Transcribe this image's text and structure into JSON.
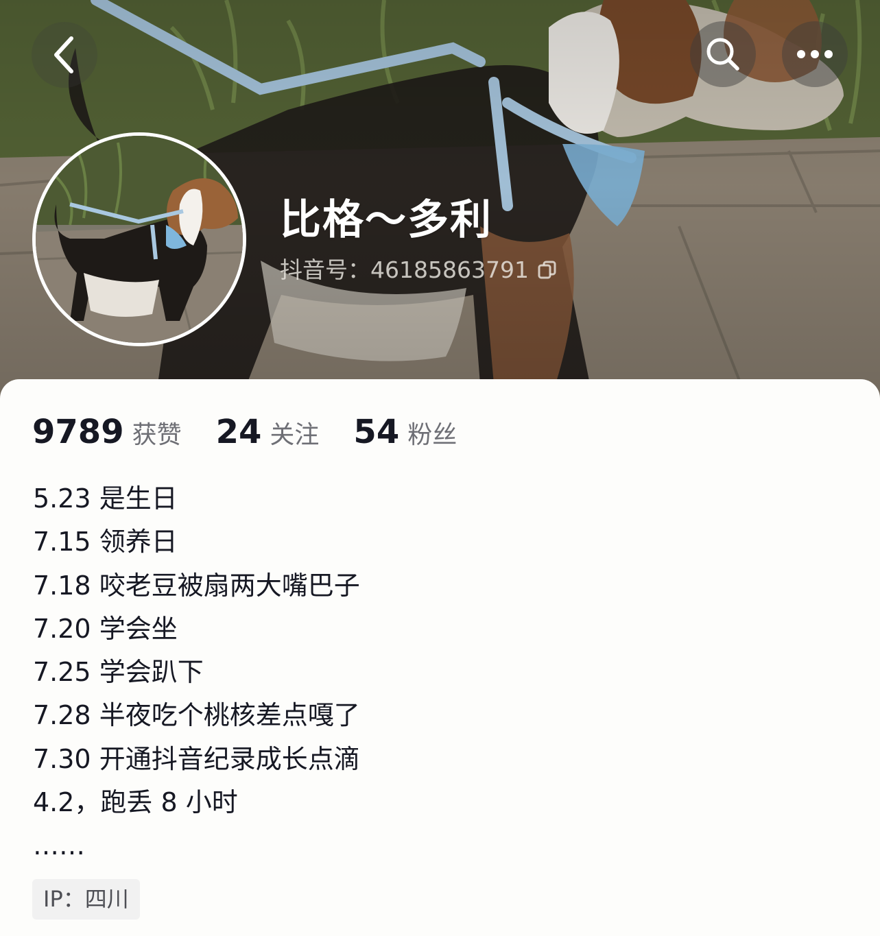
{
  "header": {
    "back_icon": "chevron-left-icon",
    "search_icon": "search-icon",
    "more_icon": "more-dots-icon"
  },
  "profile": {
    "nickname": "比格～多利",
    "douyin_id": "抖音号：46185863791",
    "copy_icon": "copy-icon"
  },
  "stats": [
    {
      "value": "9789",
      "label": "获赞"
    },
    {
      "value": "24",
      "label": "关注"
    },
    {
      "value": "54",
      "label": "粉丝"
    }
  ],
  "bio": {
    "lines": [
      "5.23 是生日",
      "7.15 领养日",
      "7.18 咬老豆被扇两大嘴巴子",
      "7.20 学会坐",
      "7.25 学会趴下",
      "7.28 半夜吃个桃核差点嘎了",
      "7.30 开通抖音纪录成长点滴",
      "4.2，跑丢 8 小时",
      "……"
    ]
  },
  "ip": {
    "label": "IP：四川"
  }
}
